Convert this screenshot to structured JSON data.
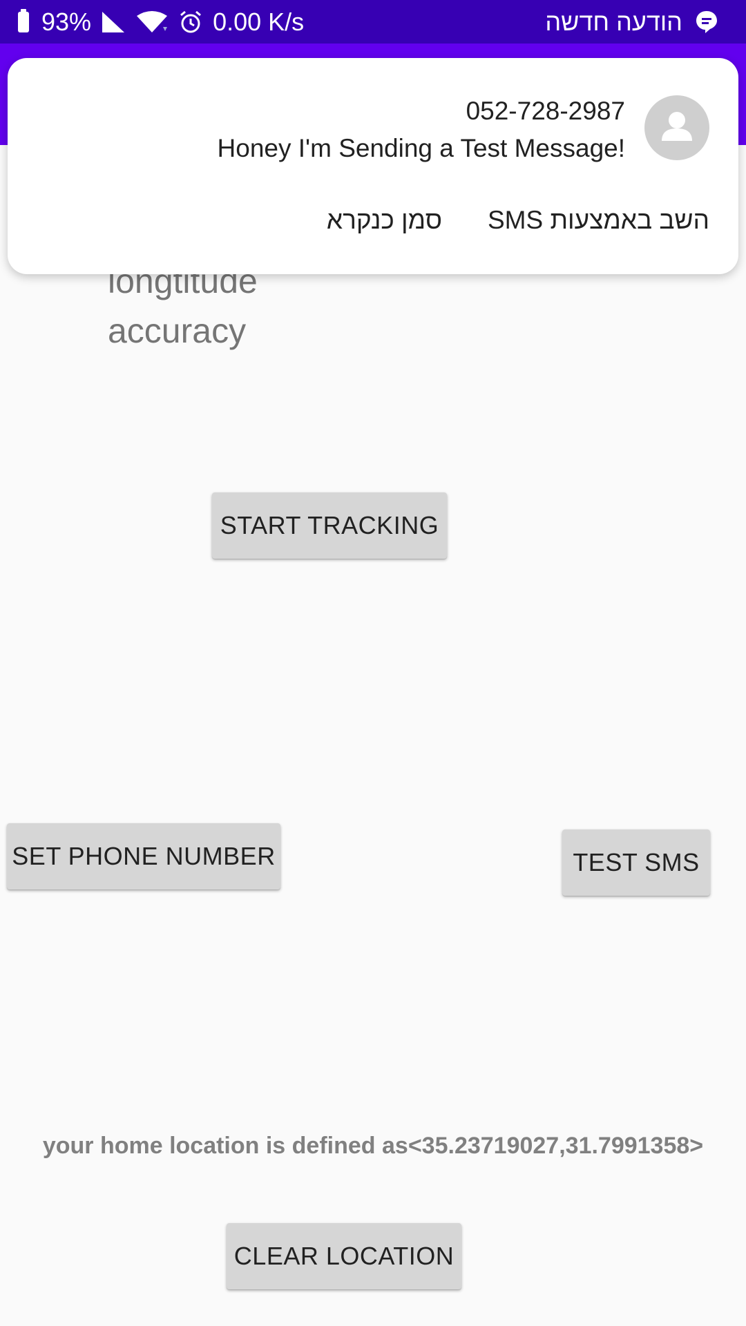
{
  "status_bar": {
    "battery_percent": "93%",
    "net_speed": "0.00 K/s",
    "notification_label": "הודעה חדשה"
  },
  "notification": {
    "sender": "052-728-2987",
    "message": "Honey I'm Sending a Test Message!",
    "action_reply": "השב באמצעות SMS",
    "action_mark_read": "סמן כנקרא"
  },
  "main": {
    "longitude_label": "longtitude",
    "accuracy_label": "accuracy",
    "start_tracking_label": "START TRACKING",
    "set_phone_label": "SET PHONE NUMBER",
    "test_sms_label": "TEST SMS",
    "home_location_text": "your home location is defined as<35.23719027,31.7991358>",
    "clear_location_label": "CLEAR LOCATION"
  },
  "colors": {
    "status_bar": "#3700b3",
    "app_bar": "#6200ee",
    "background": "#fafafa",
    "button": "#d6d6d6"
  }
}
